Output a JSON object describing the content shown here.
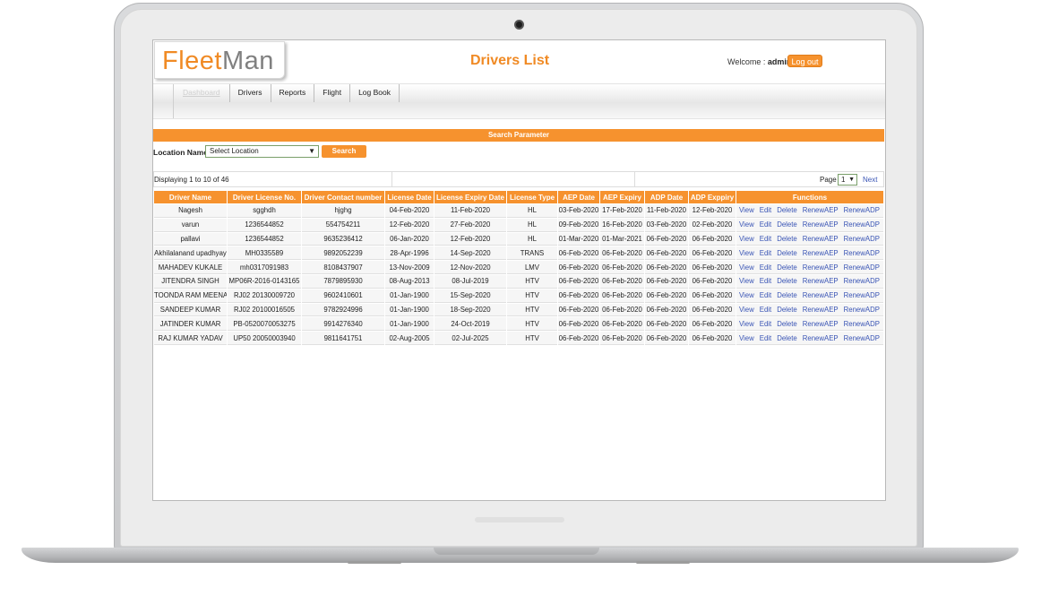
{
  "app": {
    "logo_part1": "Fleet",
    "logo_part2": "Man",
    "page_title": "Drivers List",
    "welcome_label": "Welcome : ",
    "username": "admin",
    "logout_label": "Log out"
  },
  "nav": {
    "items": [
      "Dashboard",
      "Drivers",
      "Reports",
      "Flight",
      "Log Book"
    ]
  },
  "search": {
    "bar_title": "Search Parameter",
    "location_label": "Location Name :",
    "location_value": "Select Location",
    "button_label": "Search"
  },
  "pager": {
    "display_text": "Displaying 1 to 10 of 46",
    "page_label": "Page",
    "page_value": "1",
    "next_label": "Next"
  },
  "table": {
    "headers": [
      "Driver Name",
      "Driver License No.",
      "Driver Contact number",
      "License Date",
      "License Expiry Date",
      "License Type",
      "AEP Date",
      "AEP Expiry",
      "ADP Date",
      "ADP Exppiry",
      "Functions"
    ],
    "function_labels": [
      "View",
      "Edit",
      "Delete",
      "RenewAEP",
      "RenewADP"
    ],
    "rows": [
      [
        "Nagesh",
        "sgghdh",
        "hjghg",
        "04-Feb-2020",
        "11-Feb-2020",
        "HL",
        "03-Feb-2020",
        "17-Feb-2020",
        "11-Feb-2020",
        "12-Feb-2020"
      ],
      [
        "varun",
        "1236544852",
        "554754211",
        "12-Feb-2020",
        "27-Feb-2020",
        "HL",
        "09-Feb-2020",
        "16-Feb-2020",
        "03-Feb-2020",
        "02-Feb-2020"
      ],
      [
        "pallavi",
        "1236544852",
        "9635236412",
        "06-Jan-2020",
        "12-Feb-2020",
        "HL",
        "01-Mar-2020",
        "01-Mar-2021",
        "06-Feb-2020",
        "06-Feb-2020"
      ],
      [
        "Akhilalanand upadhyay",
        "MH0335589",
        "9892052239",
        "28-Apr-1996",
        "14-Sep-2020",
        "TRANS",
        "06-Feb-2020",
        "06-Feb-2020",
        "06-Feb-2020",
        "06-Feb-2020"
      ],
      [
        "MAHADEV KUKALE",
        "mh0317091983",
        "8108437907",
        "13-Nov-2009",
        "12-Nov-2020",
        "LMV",
        "06-Feb-2020",
        "06-Feb-2020",
        "06-Feb-2020",
        "06-Feb-2020"
      ],
      [
        "JITENDRA SINGH",
        "MP06R-2016-0143165",
        "7879895930",
        "08-Aug-2013",
        "08-Jul-2019",
        "HTV",
        "06-Feb-2020",
        "06-Feb-2020",
        "06-Feb-2020",
        "06-Feb-2020"
      ],
      [
        "TOONDA RAM MEENA",
        "RJ02 20130009720",
        "9602410601",
        "01-Jan-1900",
        "15-Sep-2020",
        "HTV",
        "06-Feb-2020",
        "06-Feb-2020",
        "06-Feb-2020",
        "06-Feb-2020"
      ],
      [
        "SANDEEP KUMAR",
        "RJ02 20100016505",
        "9782924996",
        "01-Jan-1900",
        "18-Sep-2020",
        "HTV",
        "06-Feb-2020",
        "06-Feb-2020",
        "06-Feb-2020",
        "06-Feb-2020"
      ],
      [
        "JATINDER KUMAR",
        "PB-0520070053275",
        "9914276340",
        "01-Jan-1900",
        "24-Oct-2019",
        "HTV",
        "06-Feb-2020",
        "06-Feb-2020",
        "06-Feb-2020",
        "06-Feb-2020"
      ],
      [
        "RAJ KUMAR YADAV",
        "UP50 20050003940",
        "9811641751",
        "02-Aug-2005",
        "02-Jul-2025",
        "HTV",
        "06-Feb-2020",
        "06-Feb-2020",
        "06-Feb-2020",
        "06-Feb-2020"
      ]
    ]
  },
  "colors": {
    "accent": "#f6922e",
    "link": "#3a55b5"
  }
}
